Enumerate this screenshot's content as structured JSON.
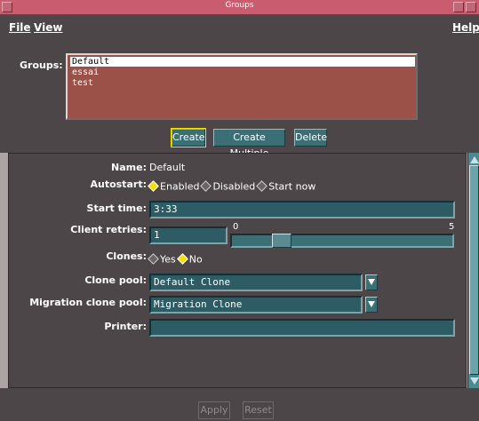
{
  "window": {
    "title": "Groups"
  },
  "menu": {
    "file": "File",
    "view": "View",
    "help": "Help"
  },
  "groups": {
    "label": "Groups:",
    "items": [
      "Default",
      "essai",
      "test"
    ],
    "selected_index": 0
  },
  "buttons": {
    "create": "Create",
    "create_multiple": "Create Multiple",
    "delete": "Delete",
    "apply": "Apply",
    "reset": "Reset"
  },
  "form": {
    "name_label": "Name:",
    "name_value": "Default",
    "autostart_label": "Autostart:",
    "autostart_options": [
      "Enabled",
      "Disabled",
      "Start now"
    ],
    "autostart_selected": "Enabled",
    "start_time_label": "Start time:",
    "start_time_value": "3:33",
    "client_retries_label": "Client retries:",
    "client_retries_value": "1",
    "client_retries_min": "0",
    "client_retries_max": "5",
    "clones_label": "Clones:",
    "clones_options": [
      "Yes",
      "No"
    ],
    "clones_selected": "No",
    "clone_pool_label": "Clone pool:",
    "clone_pool_value": "Default Clone",
    "migration_clone_pool_label": "Migration clone pool:",
    "migration_clone_pool_value": "Migration Clone",
    "printer_label": "Printer:",
    "printer_value": ""
  },
  "colors": {
    "titlebar": "#c95d6f",
    "panel": "#4d4649",
    "field": "#2d5c64",
    "list_bg": "#9b5048",
    "radio_on": "#f5e000"
  }
}
